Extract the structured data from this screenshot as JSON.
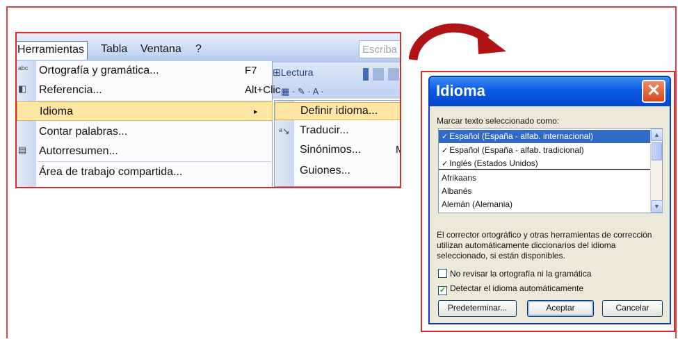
{
  "menu": {
    "menubar": {
      "herramientas": "Herramientas",
      "tabla": "Tabla",
      "ventana": "Ventana",
      "help": "?",
      "search_text": "Escriba"
    },
    "toolbar": {
      "lectura": "Lectura",
      "row2_glyphs": "▦ · ✎ · A ·"
    },
    "items": [
      {
        "label": "Ortografía y gramática...",
        "accel": "F7"
      },
      {
        "label": "Referencia...",
        "accel": "Alt+Clic"
      },
      {
        "label": "Idioma",
        "accel": "▸"
      },
      {
        "label": "Contar palabras...",
        "accel": ""
      },
      {
        "label": "Autorresumen...",
        "accel": ""
      },
      {
        "label": "Área de trabajo compartida...",
        "accel": ""
      }
    ],
    "submenu": [
      {
        "label": "Definir idioma..."
      },
      {
        "label": "Traducir..."
      },
      {
        "label": "Sinónimos...",
        "accel": "May"
      },
      {
        "label": "Guiones..."
      }
    ]
  },
  "dialog": {
    "title": "Idioma",
    "close_glyph": "✕",
    "list_label": "Marcar texto seleccionado como:",
    "languages": [
      "Español (España - alfab. internacional)",
      "Español (España - alfab. tradicional)",
      "Inglés (Estados Unidos)",
      "Afrikaans",
      "Albanés",
      "Alemán (Alemania)"
    ],
    "description": "El corrector ortográfico y otras herramientas de corrección utilizan automáticamente diccionarios del idioma seleccionado, si están disponibles.",
    "checkbox_no_revisar": "No revisar la ortografía ni la gramática",
    "checkbox_detectar": "Detectar el idioma automáticamente",
    "checkbox_no_revisar_checked": false,
    "checkbox_detectar_checked": true,
    "btn_predeterminar": "Predeterminar...",
    "btn_aceptar": "Aceptar",
    "btn_cancelar": "Cancelar"
  },
  "colors": {
    "frame_red": "#d62b2b",
    "highlight": "#ffe7a3",
    "titlebar_blue": "#0a5ae6",
    "selection_blue": "#316ac5"
  }
}
